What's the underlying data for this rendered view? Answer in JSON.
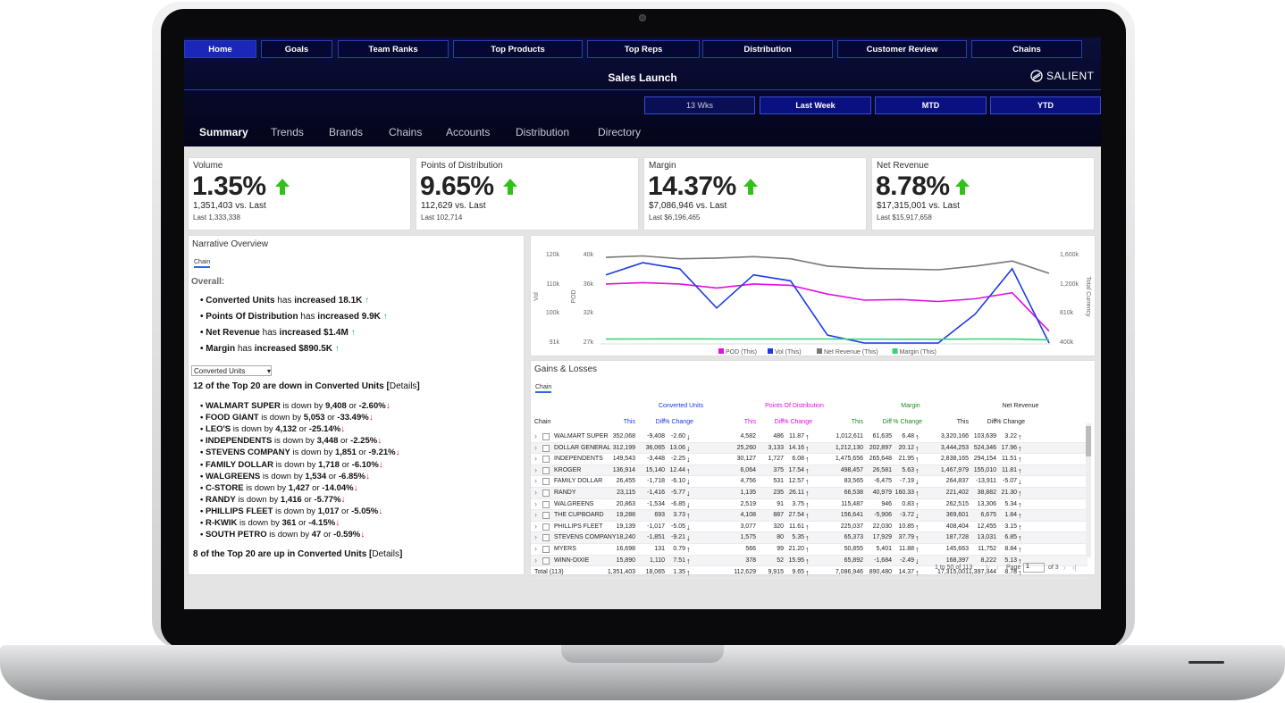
{
  "nav": [
    "Home",
    "Goals",
    "Team Ranks",
    "Top Products",
    "Top Reps",
    "Distribution",
    "Customer Review",
    "Chains"
  ],
  "title": "Sales Launch",
  "brand": "SALIENT",
  "periods": [
    "13 Wks",
    "Last Week",
    "MTD",
    "YTD"
  ],
  "tabs": [
    "Summary",
    "Trends",
    "Brands",
    "Chains",
    "Accounts",
    "Distribution",
    "Directory"
  ],
  "kpis": [
    {
      "label": "Volume",
      "value": "1.35%",
      "vs": "1,351,403 vs. Last",
      "last": "Last 1,333,338"
    },
    {
      "label": "Points of Distribution",
      "value": "9.65%",
      "vs": "112,629 vs. Last",
      "last": "Last 102,714"
    },
    {
      "label": "Margin",
      "value": "14.37%",
      "vs": "$7,086,946 vs. Last",
      "last": "Last $6,196,465"
    },
    {
      "label": "Net Revenue",
      "value": "8.78%",
      "vs": "$17,315,001 vs. Last",
      "last": "Last $15,917,658"
    }
  ],
  "narrative": {
    "title": "Narrative Overview",
    "chip": "Chain",
    "overall": "Overall:",
    "bullets": [
      {
        "name": "Converted Units",
        "mid": " has ",
        "change": "increased 18.1K"
      },
      {
        "name": "Points Of Distribution",
        "mid": " has ",
        "change": "increased 9.9K"
      },
      {
        "name": "Net Revenue",
        "mid": " has ",
        "change": "increased $1.4M"
      },
      {
        "name": "Margin",
        "mid": " has ",
        "change": "increased $890.5K"
      }
    ],
    "select": "Converted Units",
    "down_head": "12 of the Top 20 are down in Converted Units [",
    "details": "Details",
    "downs": [
      {
        "name": "WALMART SUPER",
        "by": "9,408",
        "pct": "-2.60%"
      },
      {
        "name": "FOOD GIANT",
        "by": "5,053",
        "pct": "-33.49%"
      },
      {
        "name": "LEO'S",
        "by": "4,132",
        "pct": "-25.14%"
      },
      {
        "name": "INDEPENDENTS",
        "by": "3,448",
        "pct": "-2.25%"
      },
      {
        "name": "STEVENS COMPANY",
        "by": "1,851",
        "pct": "-9.21%"
      },
      {
        "name": "FAMILY DOLLAR",
        "by": "1,718",
        "pct": "-6.10%"
      },
      {
        "name": "WALGREENS",
        "by": "1,534",
        "pct": "-6.85%"
      },
      {
        "name": "C-STORE",
        "by": "1,427",
        "pct": "-14.04%"
      },
      {
        "name": "RANDY",
        "by": "1,416",
        "pct": "-5.77%"
      },
      {
        "name": "PHILLIPS FLEET",
        "by": "1,017",
        "pct": "-5.05%"
      },
      {
        "name": "R-KWIK",
        "by": "361",
        "pct": "-4.15%"
      },
      {
        "name": "SOUTH PETRO",
        "by": "47",
        "pct": "-0.59%"
      }
    ],
    "is_down_by": " is down by ",
    "or": " or ",
    "up_head": "8 of the Top 20 are up in Converted Units [",
    "close": "]"
  },
  "chart_data": {
    "type": "line",
    "x": [
      1,
      2,
      3,
      4,
      5,
      6,
      7,
      8,
      9,
      10,
      11,
      12,
      13
    ],
    "series": [
      {
        "name": "POD (This)",
        "color": "#e010e0",
        "values": [
          35500,
          35700,
          35500,
          34900,
          35500,
          35300,
          34000,
          33100,
          33200,
          32900,
          33300,
          34200,
          28500
        ],
        "axis": "POD"
      },
      {
        "name": "Vol (This)",
        "color": "#1a3ae8",
        "values": [
          113000,
          117000,
          115000,
          102000,
          113000,
          111000,
          93000,
          88000,
          89000,
          88000,
          100000,
          115000,
          90000
        ],
        "axis": "Vol"
      },
      {
        "name": "Net Revenue (This)",
        "color": "#777777",
        "values": [
          1550000,
          1570000,
          1530000,
          1540000,
          1560000,
          1530000,
          1430000,
          1400000,
          1390000,
          1380000,
          1430000,
          1500000,
          1330000
        ],
        "axis": "Total Currency"
      },
      {
        "name": "Margin (This)",
        "color": "#3ccf7a",
        "values": [
          429000,
          431000,
          432000,
          430000,
          430000,
          430000,
          430000,
          428000,
          427000,
          427000,
          430000,
          429000,
          419000
        ],
        "axis": "Total Currency"
      }
    ],
    "y_vol_ticks": [
      "120k",
      "110k",
      "100k",
      "91k"
    ],
    "y_pod_ticks": [
      "40k",
      "36k",
      "32k",
      "27k"
    ],
    "y_cur_ticks": [
      "1,600k",
      "1,200k",
      "810k",
      "400k"
    ],
    "ylabel_vol": "Vol",
    "ylabel_pod": "POD",
    "ylabel_cur": "Total Currency"
  },
  "gains": {
    "title": "Gains & Losses",
    "chip": "Chain",
    "groups": [
      {
        "label": "Converted Units",
        "color": "#1a3ae8"
      },
      {
        "label": "Points Of Distribution",
        "color": "#e010e0"
      },
      {
        "label": "Margin",
        "color": "#1e8a1e"
      },
      {
        "label": "Net Revenue",
        "color": "#222222"
      }
    ],
    "sub": [
      "This",
      "Diff",
      "% Change"
    ],
    "chain_col": "Chain",
    "rows": [
      [
        "WALMART SUPER",
        "352,068",
        "-9,408",
        "-2.60",
        "d",
        "4,582",
        "486",
        "11.87",
        "u",
        "1,012,611",
        "61,635",
        "6.48",
        "u",
        "3,320,166",
        "103,639",
        "3.22",
        "u"
      ],
      [
        "DOLLAR GENERAL",
        "312,199",
        "36,065",
        "13.06",
        "d",
        "25,260",
        "3,133",
        "14.16",
        "u",
        "1,212,130",
        "202,897",
        "20.12",
        "u",
        "3,444,253",
        "524,346",
        "17.96",
        "u"
      ],
      [
        "INDEPENDENTS",
        "149,543",
        "-3,448",
        "-2.25",
        "d",
        "30,127",
        "1,727",
        "6.08",
        "u",
        "1,475,656",
        "265,648",
        "21.95",
        "u",
        "2,838,165",
        "294,154",
        "11.51",
        "u"
      ],
      [
        "KROGER",
        "136,914",
        "15,140",
        "12.44",
        "u",
        "6,064",
        "375",
        "17.54",
        "u",
        "498,457",
        "26,581",
        "5.63",
        "u",
        "1,467,979",
        "155,010",
        "11.81",
        "u"
      ],
      [
        "FAMILY DOLLAR",
        "26,455",
        "-1,718",
        "-6.10",
        "d",
        "4,756",
        "531",
        "12.57",
        "u",
        "83,565",
        "-6,475",
        "-7.19",
        "d",
        "264,837",
        "-13,911",
        "-5.07",
        "d"
      ],
      [
        "RANDY",
        "23,115",
        "-1,416",
        "-5.77",
        "d",
        "1,135",
        "235",
        "26.11",
        "u",
        "66,538",
        "40,979",
        "160.33",
        "u",
        "221,402",
        "38,882",
        "21.30",
        "u"
      ],
      [
        "WALGREENS",
        "20,863",
        "-1,534",
        "-6.85",
        "d",
        "2,519",
        "91",
        "3.75",
        "u",
        "115,487",
        "946",
        "0.83",
        "u",
        "262,515",
        "13,306",
        "5.34",
        "u"
      ],
      [
        "THE CUPBOARD",
        "19,288",
        "693",
        "3.73",
        "u",
        "4,108",
        "887",
        "27.54",
        "u",
        "156,641",
        "-5,906",
        "-3.72",
        "d",
        "369,601",
        "6,675",
        "1.84",
        "u"
      ],
      [
        "PHILLIPS FLEET",
        "19,139",
        "-1,017",
        "-5.05",
        "d",
        "3,077",
        "320",
        "11.61",
        "u",
        "225,037",
        "22,030",
        "10.85",
        "u",
        "408,404",
        "12,455",
        "3.15",
        "u"
      ],
      [
        "STEVENS COMPANY",
        "18,240",
        "-1,851",
        "-9.21",
        "d",
        "1,575",
        "80",
        "5.35",
        "u",
        "65,373",
        "17,929",
        "37.79",
        "u",
        "187,728",
        "13,031",
        "6.85",
        "u"
      ],
      [
        "MYERS",
        "16,698",
        "131",
        "0.79",
        "u",
        "566",
        "99",
        "21.20",
        "u",
        "50,855",
        "5,401",
        "11.88",
        "u",
        "145,663",
        "11,752",
        "8.84",
        "u"
      ],
      [
        "WINN-DIXIE",
        "15,890",
        "1,110",
        "7.51",
        "u",
        "378",
        "52",
        "15.95",
        "u",
        "65,892",
        "-1,684",
        "-2.49",
        "d",
        "168,397",
        "8,222",
        "5.13",
        "u"
      ]
    ],
    "total": [
      "Total (113)",
      "1,351,403",
      "18,065",
      "1.35",
      "u",
      "112,629",
      "9,915",
      "9.65",
      "u",
      "7,086,946",
      "890,480",
      "14.37",
      "u",
      "17,315,001",
      "1,397,344",
      "8.78",
      "u"
    ],
    "pager_range": "1 to 50 of 113",
    "pager_page": "Page",
    "pager_num": "1",
    "pager_of": "of 3"
  }
}
